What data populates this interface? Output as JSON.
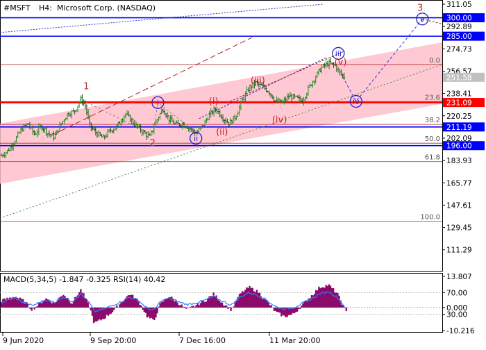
{
  "header": {
    "symbol": "#MSFT",
    "timeframe": "H4:",
    "instrument": "Microsoft Corp. (NASDAQ)"
  },
  "indicator_header": "MACD(5,34,5) -1.847 -0.325 RSI(14) 40.42",
  "colors": {
    "background": "#ffffff",
    "channel_fill": "#ffc0cb",
    "bars": "#1f7a1f",
    "blue_level": "#0000ff",
    "red_level": "#ff0000",
    "fib_line": "#b22222",
    "wave_red": "#cc2222",
    "wave_brown": "#b0332a",
    "wave_blue": "#2020cc",
    "macd_hist": "#8b0a6a",
    "rsi_line": "#2f7fff",
    "price_tag_blue": "#0000ff",
    "price_tag_red": "#ff0000",
    "price_tag_grey": "#c0c0c0"
  },
  "chart_data": {
    "type": "candlestick",
    "x_tick_labels": [
      "9 Jun 2020",
      "9 Sep 20:00",
      "7 Dec 16:00",
      "11 Mar 20:00"
    ],
    "price_axis": {
      "ylim": [
        102.1,
        311.05
      ],
      "tick_labels": [
        "311.05",
        "292.89",
        "274.73",
        "256.57",
        "238.41",
        "220.25",
        "202.09",
        "183.93",
        "165.77",
        "147.61",
        "129.45",
        "111.29"
      ]
    },
    "price_tags": [
      {
        "label": "300.00",
        "value": 300.0,
        "style": "blue"
      },
      {
        "label": "285.00",
        "value": 285.0,
        "style": "blue"
      },
      {
        "label": "251.58",
        "value": 251.58,
        "style": "grey"
      },
      {
        "label": "231.09",
        "value": 231.09,
        "style": "red"
      },
      {
        "label": "211.19",
        "value": 211.19,
        "style": "blue"
      },
      {
        "label": "196.00",
        "value": 196.0,
        "style": "blue"
      }
    ],
    "levels": [
      {
        "value": 300.0,
        "kind": "blue"
      },
      {
        "value": 285.0,
        "kind": "blue"
      },
      {
        "value": 231.09,
        "kind": "red"
      },
      {
        "value": 211.19,
        "kind": "blue"
      },
      {
        "value": 196.0,
        "kind": "blue"
      }
    ],
    "fibonacci": [
      {
        "label": "0.0",
        "value": 262.0
      },
      {
        "label": "23.6",
        "value": 231.8
      },
      {
        "label": "38.2",
        "value": 213.3
      },
      {
        "label": "50.0",
        "value": 198.0
      },
      {
        "label": "61.8",
        "value": 183.0
      },
      {
        "label": "100.0",
        "value": 134.5
      }
    ],
    "channel": {
      "upper": [
        [
          0,
          214
        ],
        [
          1,
          280
        ]
      ],
      "lower": [
        [
          0,
          165
        ],
        [
          1,
          230
        ]
      ]
    },
    "price_series": [
      [
        0.0,
        188
      ],
      [
        0.015,
        192
      ],
      [
        0.03,
        200
      ],
      [
        0.045,
        209
      ],
      [
        0.06,
        214
      ],
      [
        0.075,
        205
      ],
      [
        0.09,
        212
      ],
      [
        0.105,
        206
      ],
      [
        0.12,
        203
      ],
      [
        0.135,
        214
      ],
      [
        0.15,
        222
      ],
      [
        0.165,
        224
      ],
      [
        0.18,
        234
      ],
      [
        0.19,
        228
      ],
      [
        0.2,
        212
      ],
      [
        0.215,
        206
      ],
      [
        0.23,
        202
      ],
      [
        0.245,
        208
      ],
      [
        0.26,
        211
      ],
      [
        0.28,
        222
      ],
      [
        0.3,
        214
      ],
      [
        0.32,
        207
      ],
      [
        0.335,
        203
      ],
      [
        0.35,
        216
      ],
      [
        0.365,
        226
      ],
      [
        0.38,
        217
      ],
      [
        0.395,
        213
      ],
      [
        0.41,
        214
      ],
      [
        0.425,
        210
      ],
      [
        0.44,
        206
      ],
      [
        0.455,
        212
      ],
      [
        0.47,
        221
      ],
      [
        0.485,
        226
      ],
      [
        0.5,
        219
      ],
      [
        0.515,
        214
      ],
      [
        0.53,
        220
      ],
      [
        0.545,
        233
      ],
      [
        0.56,
        243
      ],
      [
        0.575,
        247
      ],
      [
        0.59,
        244
      ],
      [
        0.605,
        240
      ],
      [
        0.62,
        232
      ],
      [
        0.635,
        231
      ],
      [
        0.65,
        236
      ],
      [
        0.665,
        235
      ],
      [
        0.68,
        232
      ],
      [
        0.695,
        243
      ],
      [
        0.71,
        252
      ],
      [
        0.725,
        260
      ],
      [
        0.74,
        263
      ],
      [
        0.755,
        261
      ],
      [
        0.765,
        255
      ],
      [
        0.775,
        252
      ]
    ],
    "annotations": {
      "wave_labels": [
        {
          "text": "1",
          "color": "brown",
          "circled": false,
          "x": 0.195,
          "price": 244
        },
        {
          "text": "2",
          "color": "brown",
          "circled": false,
          "x": 0.345,
          "price": 198
        },
        {
          "text": "3",
          "color": "brown",
          "circled": false,
          "x": 0.95,
          "price": 308
        },
        {
          "text": "i",
          "color": "blue",
          "circled": true,
          "x": 0.357,
          "price": 231
        },
        {
          "text": "ii",
          "color": "blue",
          "circled": true,
          "x": 0.443,
          "price": 202
        },
        {
          "text": "iii",
          "color": "blue",
          "circled": true,
          "x": 0.765,
          "price": 271
        },
        {
          "text": "iv",
          "color": "blue",
          "circled": true,
          "x": 0.805,
          "price": 232
        },
        {
          "text": "v",
          "color": "blue",
          "circled": true,
          "x": 0.955,
          "price": 299
        },
        {
          "text": "(i)",
          "color": "red",
          "circled": false,
          "x": 0.483,
          "price": 232
        },
        {
          "text": "(ii)",
          "color": "red",
          "circled": false,
          "x": 0.502,
          "price": 207
        },
        {
          "text": "(iii)",
          "color": "red",
          "circled": false,
          "x": 0.583,
          "price": 249
        },
        {
          "text": "(iv)",
          "color": "red",
          "circled": false,
          "x": 0.632,
          "price": 217
        },
        {
          "text": "(v)",
          "color": "red",
          "circled": false,
          "x": 0.77,
          "price": 264
        }
      ]
    },
    "indicator_panel": {
      "axis_labels": [
        "13.807",
        "70.00",
        "0.000",
        "30.00",
        "-10.216"
      ],
      "macd_ylim": [
        -10.216,
        13.807
      ],
      "rsi_levels": [
        70,
        30
      ],
      "macd_histogram_profile": [
        [
          0.0,
          3
        ],
        [
          0.03,
          5
        ],
        [
          0.05,
          3
        ],
        [
          0.07,
          -1
        ],
        [
          0.1,
          4
        ],
        [
          0.12,
          2
        ],
        [
          0.14,
          6
        ],
        [
          0.16,
          2
        ],
        [
          0.18,
          8
        ],
        [
          0.2,
          0
        ],
        [
          0.21,
          -7
        ],
        [
          0.23,
          -5
        ],
        [
          0.25,
          -2
        ],
        [
          0.27,
          2
        ],
        [
          0.29,
          6
        ],
        [
          0.31,
          3
        ],
        [
          0.33,
          -4
        ],
        [
          0.345,
          -6
        ],
        [
          0.36,
          2
        ],
        [
          0.38,
          5
        ],
        [
          0.4,
          2
        ],
        [
          0.42,
          -1
        ],
        [
          0.44,
          1
        ],
        [
          0.46,
          3
        ],
        [
          0.48,
          6
        ],
        [
          0.5,
          2
        ],
        [
          0.52,
          -1
        ],
        [
          0.54,
          6
        ],
        [
          0.56,
          9
        ],
        [
          0.58,
          7
        ],
        [
          0.6,
          3
        ],
        [
          0.62,
          -2
        ],
        [
          0.64,
          -4
        ],
        [
          0.66,
          -3
        ],
        [
          0.68,
          1
        ],
        [
          0.7,
          5
        ],
        [
          0.72,
          9
        ],
        [
          0.74,
          10
        ],
        [
          0.76,
          6
        ],
        [
          0.78,
          -2
        ]
      ],
      "rsi_profile": [
        [
          0.0,
          52
        ],
        [
          0.03,
          60
        ],
        [
          0.05,
          52
        ],
        [
          0.07,
          46
        ],
        [
          0.1,
          57
        ],
        [
          0.12,
          52
        ],
        [
          0.14,
          62
        ],
        [
          0.16,
          54
        ],
        [
          0.18,
          68
        ],
        [
          0.2,
          50
        ],
        [
          0.21,
          35
        ],
        [
          0.23,
          39
        ],
        [
          0.25,
          46
        ],
        [
          0.27,
          53
        ],
        [
          0.29,
          62
        ],
        [
          0.31,
          55
        ],
        [
          0.33,
          41
        ],
        [
          0.345,
          37
        ],
        [
          0.36,
          54
        ],
        [
          0.38,
          60
        ],
        [
          0.4,
          53
        ],
        [
          0.42,
          48
        ],
        [
          0.44,
          51
        ],
        [
          0.46,
          56
        ],
        [
          0.48,
          63
        ],
        [
          0.5,
          54
        ],
        [
          0.52,
          47
        ],
        [
          0.54,
          62
        ],
        [
          0.56,
          70
        ],
        [
          0.58,
          65
        ],
        [
          0.6,
          56
        ],
        [
          0.62,
          44
        ],
        [
          0.64,
          40
        ],
        [
          0.66,
          42
        ],
        [
          0.68,
          50
        ],
        [
          0.7,
          58
        ],
        [
          0.72,
          68
        ],
        [
          0.74,
          72
        ],
        [
          0.76,
          61
        ],
        [
          0.78,
          40
        ]
      ]
    }
  }
}
